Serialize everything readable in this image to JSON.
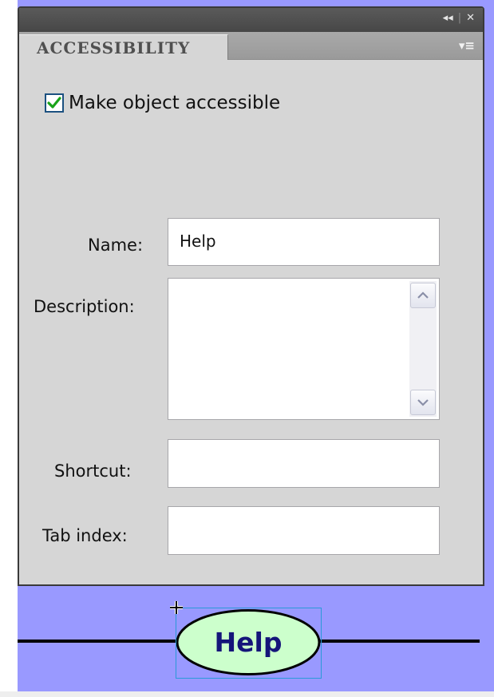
{
  "panel": {
    "tab_label": "ACCESSIBILITY",
    "title_controls": {
      "collapse_glyph": "◂◂",
      "separator": "|",
      "close_glyph": "✕"
    },
    "menu_glyph": "▾≡"
  },
  "form": {
    "make_accessible_label": "Make object accessible",
    "make_accessible_checked": true,
    "name_label": "Name:",
    "name_value": "Help",
    "description_label": "Description:",
    "description_value": "",
    "shortcut_label": "Shortcut:",
    "shortcut_value": "",
    "tab_index_label": "Tab index:",
    "tab_index_value": ""
  },
  "stage": {
    "button_label": "Help",
    "stage_color": "#9999ff",
    "button_fill": "#ccffcc",
    "button_text_color": "#15157a",
    "selection_color": "#2a9ad8"
  },
  "icons": {
    "collapse": "double-chevron-left-icon",
    "close": "close-icon",
    "panel_menu": "panel-menu-icon",
    "check": "checkmark-icon",
    "scroll_up": "chevron-up-icon",
    "scroll_down": "chevron-down-icon",
    "crosshair": "crosshair-icon"
  },
  "colors": {
    "panel_bg": "#d6d6d6",
    "title_bar": "#4d4d4d",
    "tab_strip": "#9f9f9f",
    "checkbox_border": "#1c5180",
    "check_mark": "#1aa31a"
  }
}
